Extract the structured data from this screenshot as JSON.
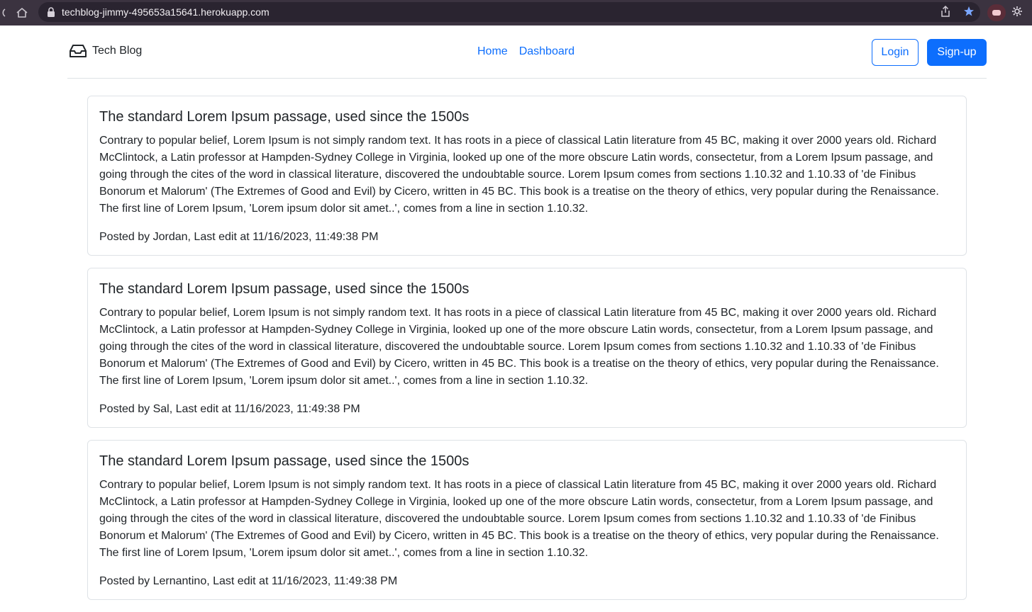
{
  "browser": {
    "url": "techblog-jimmy-495653a15641.herokuapp.com"
  },
  "header": {
    "brand": "Tech Blog",
    "nav": [
      {
        "label": "Home"
      },
      {
        "label": "Dashboard"
      }
    ],
    "login_label": "Login",
    "signup_label": "Sign-up"
  },
  "posts": [
    {
      "title": "The standard Lorem Ipsum passage, used since the 1500s",
      "body": "Contrary to popular belief, Lorem Ipsum is not simply random text. It has roots in a piece of classical Latin literature from 45 BC, making it over 2000 years old. Richard McClintock, a Latin professor at Hampden-Sydney College in Virginia, looked up one of the more obscure Latin words, consectetur, from a Lorem Ipsum passage, and going through the cites of the word in classical literature, discovered the undoubtable source. Lorem Ipsum comes from sections 1.10.32 and 1.10.33 of 'de Finibus Bonorum et Malorum' (The Extremes of Good and Evil) by Cicero, written in 45 BC. This book is a treatise on the theory of ethics, very popular during the Renaissance. The first line of Lorem Ipsum, 'Lorem ipsum dolor sit amet..', comes from a line in section 1.10.32.",
      "meta": "Posted by Jordan, Last edit at 11/16/2023, 11:49:38 PM"
    },
    {
      "title": "The standard Lorem Ipsum passage, used since the 1500s",
      "body": "Contrary to popular belief, Lorem Ipsum is not simply random text. It has roots in a piece of classical Latin literature from 45 BC, making it over 2000 years old. Richard McClintock, a Latin professor at Hampden-Sydney College in Virginia, looked up one of the more obscure Latin words, consectetur, from a Lorem Ipsum passage, and going through the cites of the word in classical literature, discovered the undoubtable source. Lorem Ipsum comes from sections 1.10.32 and 1.10.33 of 'de Finibus Bonorum et Malorum' (The Extremes of Good and Evil) by Cicero, written in 45 BC. This book is a treatise on the theory of ethics, very popular during the Renaissance. The first line of Lorem Ipsum, 'Lorem ipsum dolor sit amet..', comes from a line in section 1.10.32.",
      "meta": "Posted by Sal, Last edit at 11/16/2023, 11:49:38 PM"
    },
    {
      "title": "The standard Lorem Ipsum passage, used since the 1500s",
      "body": "Contrary to popular belief, Lorem Ipsum is not simply random text. It has roots in a piece of classical Latin literature from 45 BC, making it over 2000 years old. Richard McClintock, a Latin professor at Hampden-Sydney College in Virginia, looked up one of the more obscure Latin words, consectetur, from a Lorem Ipsum passage, and going through the cites of the word in classical literature, discovered the undoubtable source. Lorem Ipsum comes from sections 1.10.32 and 1.10.33 of 'de Finibus Bonorum et Malorum' (The Extremes of Good and Evil) by Cicero, written in 45 BC. This book is a treatise on the theory of ethics, very popular during the Renaissance. The first line of Lorem Ipsum, 'Lorem ipsum dolor sit amet..', comes from a line in section 1.10.32.",
      "meta": "Posted by Lernantino, Last edit at 11/16/2023, 11:49:38 PM"
    }
  ],
  "colors": {
    "accent": "#0d6efd",
    "text": "#212529",
    "border": "#dee2e6",
    "browser_bar": "#3b3340"
  },
  "icons": {
    "brand": "inbox-tray-icon",
    "reload": "reload-icon",
    "home": "home-icon",
    "lock": "lock-icon",
    "share": "share-icon",
    "bookmark": "star-icon",
    "extension": "extension-icon",
    "settings": "gear-icon"
  }
}
